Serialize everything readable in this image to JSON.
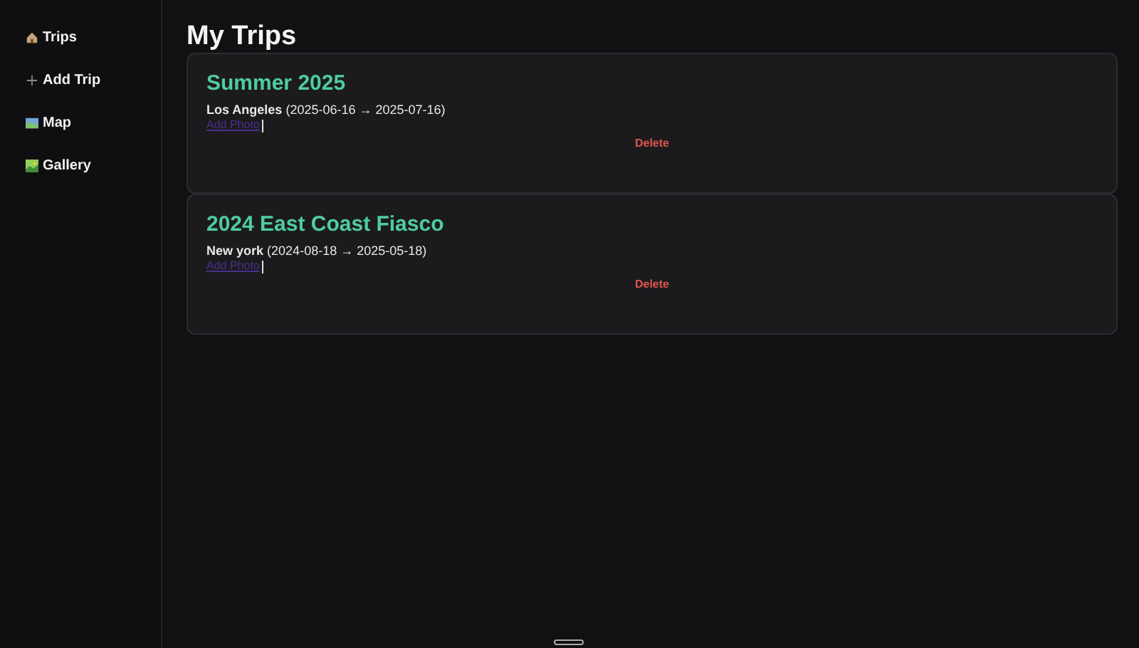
{
  "sidebar": {
    "items": [
      {
        "label": "Trips",
        "kind": "home",
        "selected": false
      },
      {
        "label": "Add Trip",
        "kind": "add",
        "selected": false
      },
      {
        "label": "Map",
        "kind": "map",
        "selected": false
      },
      {
        "label": "Gallery",
        "kind": "gallery",
        "selected": false
      }
    ]
  },
  "page_title": "My Trips",
  "trips": [
    {
      "title": "Summer 2025",
      "place": "Los Angeles",
      "dates": "(2025-06-16 → 2025-07-16)",
      "add_photo": "Add Photo",
      "delete": "Delete"
    },
    {
      "title": "2024 East Coast Fiasco",
      "place": "New york",
      "dates": "(2024-08-18 → 2025-05-18)",
      "add_photo": "Add Photo",
      "delete": "Delete"
    }
  ]
}
